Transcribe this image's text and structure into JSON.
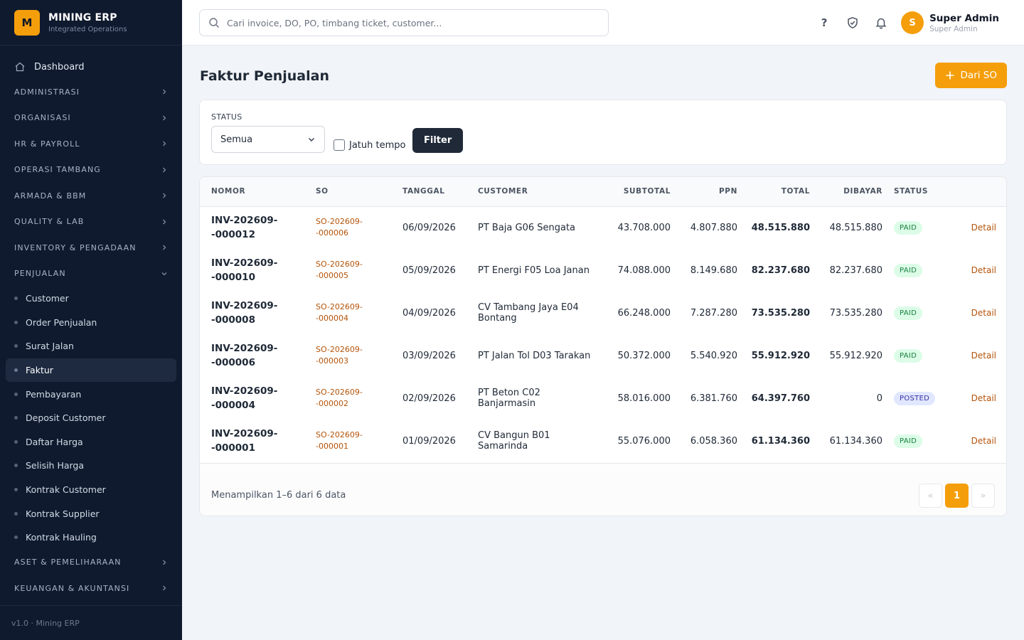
{
  "brand": {
    "logo_letter": "M",
    "title": "MINING ERP",
    "subtitle": "Integrated Operations"
  },
  "sidebar": {
    "dashboard": "Dashboard",
    "sections_top": [
      "ADMINISTRASI",
      "ORGANISASI",
      "HR & PAYROLL",
      "OPERASI TAMBANG",
      "ARMADA & BBM",
      "QUALITY & LAB",
      "INVENTORY & PENGADAAN"
    ],
    "open_section": "PENJUALAN",
    "sub_items": [
      "Customer",
      "Order Penjualan",
      "Surat Jalan",
      "Faktur",
      "Pembayaran",
      "Deposit Customer",
      "Daftar Harga",
      "Selisih Harga",
      "Kontrak Customer",
      "Kontrak Supplier",
      "Kontrak Hauling"
    ],
    "active_item": "Faktur",
    "sections_bottom": [
      "ASET & PEMELIHARAAN",
      "KEUANGAN & AKUNTANSI"
    ],
    "footer": "v1.0 · Mining ERP"
  },
  "topbar": {
    "search_placeholder": "Cari invoice, DO, PO, timbang ticket, customer...",
    "help_label": "?",
    "user": {
      "initial": "S",
      "name": "Super Admin",
      "role": "Super Admin"
    }
  },
  "page": {
    "title": "Faktur Penjualan",
    "new_button": "Dari SO"
  },
  "filter": {
    "status_label": "STATUS",
    "status_value": "Semua",
    "due_label": "Jatuh tempo",
    "button": "Filter"
  },
  "table": {
    "columns": [
      "NOMOR",
      "SO",
      "TANGGAL",
      "CUSTOMER",
      "SUBTOTAL",
      "PPN",
      "TOTAL",
      "DIBAYAR",
      "STATUS"
    ],
    "action_label": "Detail",
    "rows": [
      {
        "nomor": [
          "INV-202609-",
          "-000012"
        ],
        "so": [
          "SO-202609-",
          "-000006"
        ],
        "tanggal": "06/09/2026",
        "customer": "PT Baja G06 Sengata",
        "subtotal": "43.708.000",
        "ppn": "4.807.880",
        "total": "48.515.880",
        "dibayar": "48.515.880",
        "status": "PAID"
      },
      {
        "nomor": [
          "INV-202609-",
          "-000010"
        ],
        "so": [
          "SO-202609-",
          "-000005"
        ],
        "tanggal": "05/09/2026",
        "customer": "PT Energi F05 Loa Janan",
        "subtotal": "74.088.000",
        "ppn": "8.149.680",
        "total": "82.237.680",
        "dibayar": "82.237.680",
        "status": "PAID"
      },
      {
        "nomor": [
          "INV-202609-",
          "-000008"
        ],
        "so": [
          "SO-202609-",
          "-000004"
        ],
        "tanggal": "04/09/2026",
        "customer": "CV Tambang Jaya E04 Bontang",
        "subtotal": "66.248.000",
        "ppn": "7.287.280",
        "total": "73.535.280",
        "dibayar": "73.535.280",
        "status": "PAID"
      },
      {
        "nomor": [
          "INV-202609-",
          "-000006"
        ],
        "so": [
          "SO-202609-",
          "-000003"
        ],
        "tanggal": "03/09/2026",
        "customer": "PT Jalan Tol D03 Tarakan",
        "subtotal": "50.372.000",
        "ppn": "5.540.920",
        "total": "55.912.920",
        "dibayar": "55.912.920",
        "status": "PAID"
      },
      {
        "nomor": [
          "INV-202609-",
          "-000004"
        ],
        "so": [
          "SO-202609-",
          "-000002"
        ],
        "tanggal": "02/09/2026",
        "customer": "PT Beton C02 Banjarmasin",
        "subtotal": "58.016.000",
        "ppn": "6.381.760",
        "total": "64.397.760",
        "dibayar": "0",
        "status": "POSTED"
      },
      {
        "nomor": [
          "INV-202609-",
          "-000001"
        ],
        "so": [
          "SO-202609-",
          "-000001"
        ],
        "tanggal": "01/09/2026",
        "customer": "CV Bangun B01 Samarinda",
        "subtotal": "55.076.000",
        "ppn": "6.058.360",
        "total": "61.134.360",
        "dibayar": "61.134.360",
        "status": "PAID"
      }
    ],
    "footer_text": "Menampilkan 1–6 dari 6 data",
    "pager": {
      "prev": "«",
      "current": "1",
      "next": "»"
    }
  },
  "colors": {
    "accent": "#f59e0b",
    "sidebar_bg": "#0f1a2e",
    "paid_bg": "#dcfce7",
    "posted_bg": "#e0e7ff"
  }
}
